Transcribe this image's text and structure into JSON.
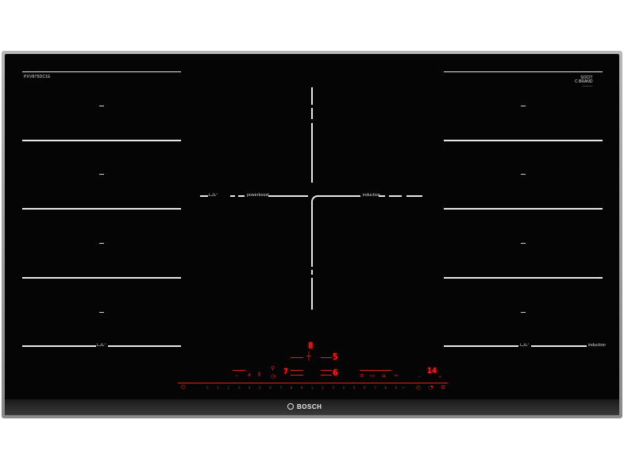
{
  "model_code": "PXV875DC1E",
  "brand": "BOSCH",
  "badge": {
    "line1": "SOCIT",
    "line2": "C BRAND",
    "underline": "──────"
  },
  "labels": {
    "powerboost": "powerboost",
    "induction_center": "induction",
    "induction_right": "induction",
    "flex_left_center": "ᒪᒍᒪᐟ",
    "flex_left_bottom": "ᒪᒍᒪᐟ",
    "flex_right_bottom": "ᒪᒍᒪᐟ"
  },
  "displays": {
    "top": "8",
    "right_upper": "5",
    "right_lower": "6",
    "left_lower": "7",
    "timer": "14"
  },
  "scale": [
    "0",
    "1",
    "2",
    "3",
    "4",
    "5",
    "6",
    "7",
    "8",
    "9",
    "1",
    "2",
    "3",
    "4",
    "5",
    "6",
    "7",
    "8",
    "9"
  ],
  "colors": {
    "glass": "#050505",
    "lines": "#e8e8e8",
    "controls": "#ff2020"
  }
}
